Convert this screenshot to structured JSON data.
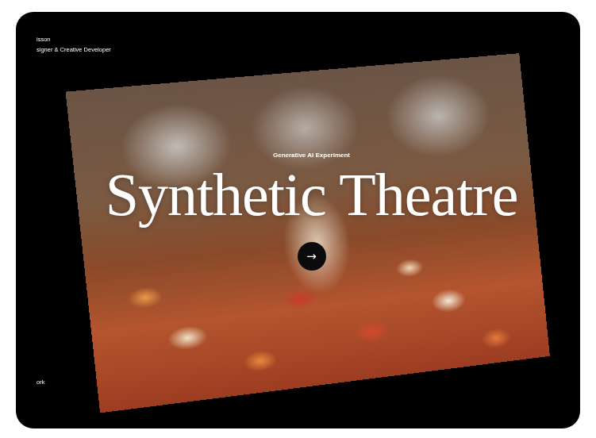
{
  "header": {
    "name": "isson",
    "role": "signer & Creative Developer"
  },
  "hero": {
    "eyebrow": "Generative AI Experiment",
    "title": "Synthetic Theatre",
    "button": "→"
  },
  "footer": {
    "link": "ork"
  }
}
